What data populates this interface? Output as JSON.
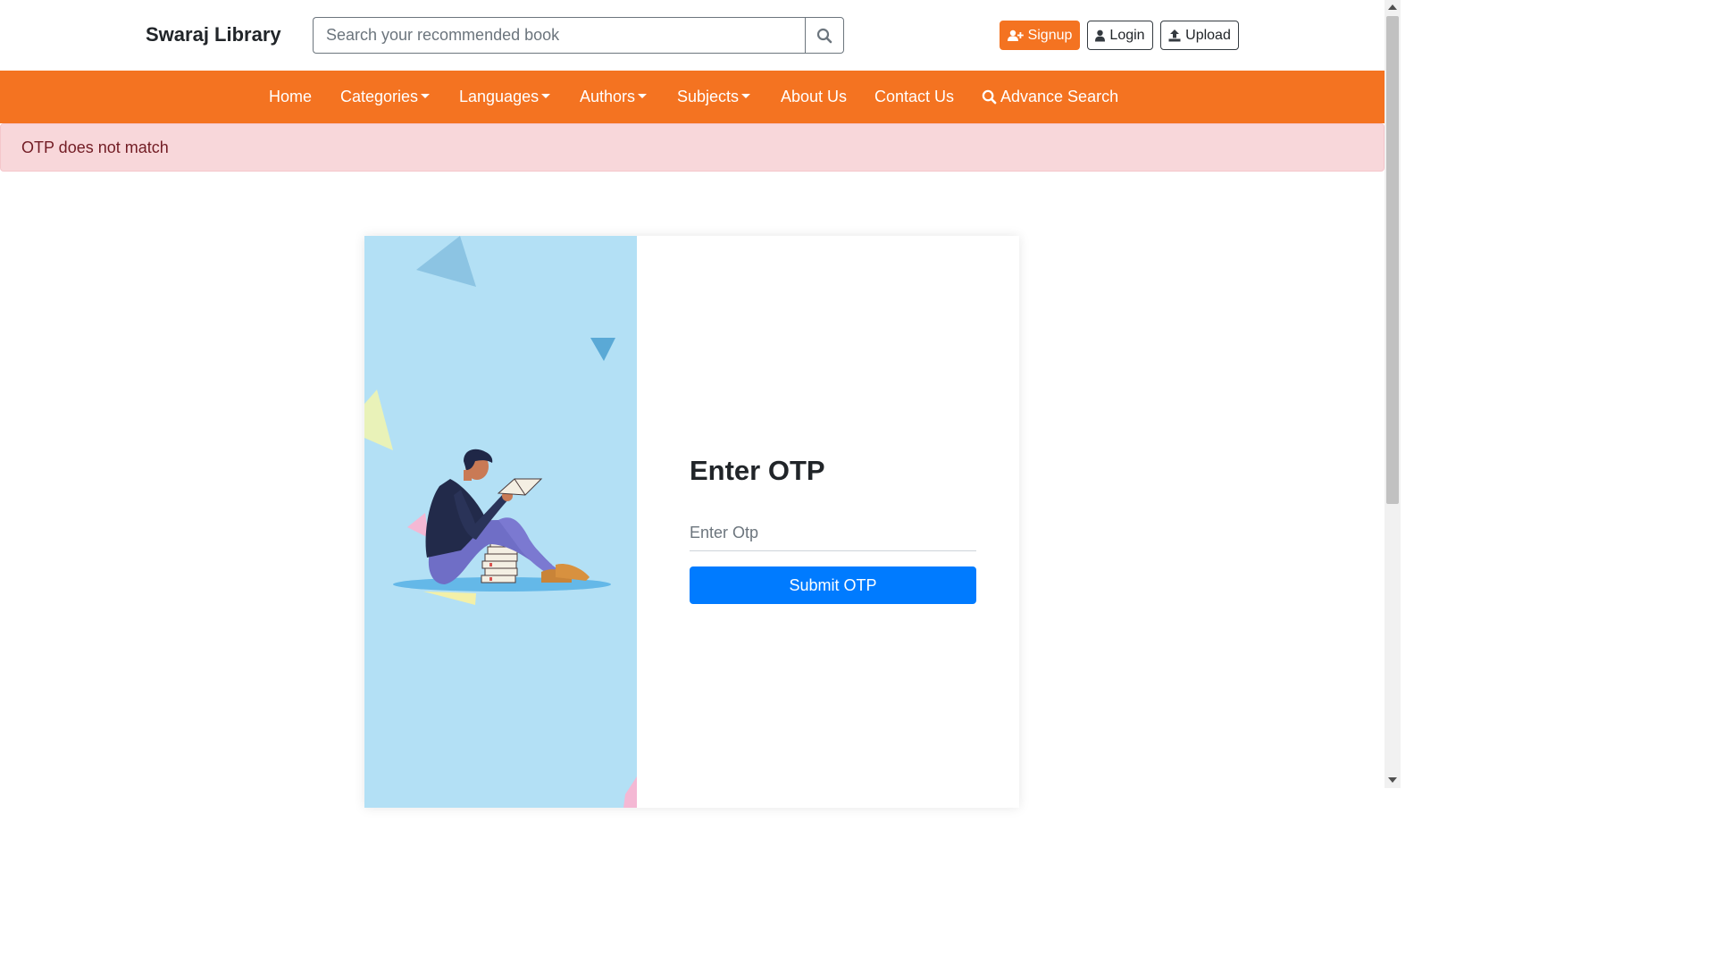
{
  "header": {
    "brand": "Swaraj Library",
    "search_placeholder": "Search your recommended book",
    "signup_label": "Signup",
    "login_label": "Login",
    "upload_label": "Upload"
  },
  "nav": {
    "home": "Home",
    "categories": "Categories",
    "languages": "Languages",
    "authors": "Authors",
    "subjects": "Subjects",
    "about": "About Us",
    "contact": "Contact Us",
    "advance_search": "Advance Search"
  },
  "alert": {
    "message": "OTP does not match"
  },
  "otp_form": {
    "title": "Enter OTP",
    "input_placeholder": "Enter Otp",
    "submit_label": "Submit OTP"
  },
  "colors": {
    "brand_orange": "#f47321",
    "alert_bg": "#f8d7da",
    "primary_blue": "#007bff",
    "illustration_bg": "#b3e0f5"
  }
}
